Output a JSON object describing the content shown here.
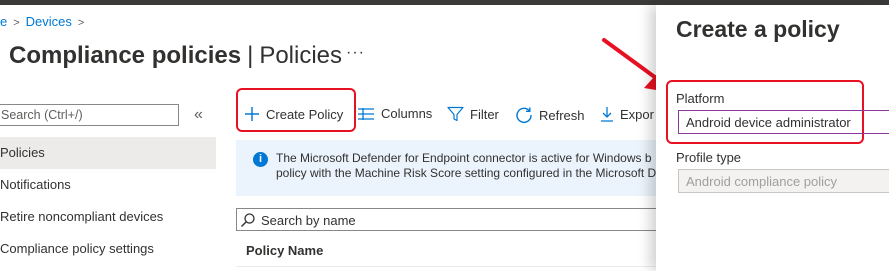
{
  "breadcrumb": {
    "items": [
      "e",
      "Devices"
    ]
  },
  "header": {
    "title_main": "Compliance policies",
    "title_separator": "|",
    "title_sub": "Policies",
    "more_label": "···"
  },
  "sidebar": {
    "search_placeholder": "Search (Ctrl+/)",
    "collapse_label": "«",
    "items": [
      {
        "label": "Policies",
        "active": true
      },
      {
        "label": "Notifications"
      },
      {
        "label": "Retire noncompliant devices"
      },
      {
        "label": "Compliance policy settings"
      }
    ]
  },
  "toolbar": {
    "create_label": "Create Policy",
    "columns_label": "Columns",
    "filter_label": "Filter",
    "refresh_label": "Refresh",
    "export_label": "Expor"
  },
  "banner": {
    "line1": "The Microsoft Defender for Endpoint connector is active for Windows b",
    "line2": "policy with the Machine Risk Score setting configured in the Microsoft D"
  },
  "list": {
    "search_placeholder": "Search by name",
    "column_header": "Policy Name"
  },
  "panel": {
    "title": "Create a policy",
    "platform_label": "Platform",
    "platform_value": "Android device administrator",
    "profile_label": "Profile type",
    "profile_value": "Android compliance policy"
  },
  "colors": {
    "accent": "#0078d4",
    "highlight": "#e81123",
    "banner_bg": "#ebf3fc"
  }
}
